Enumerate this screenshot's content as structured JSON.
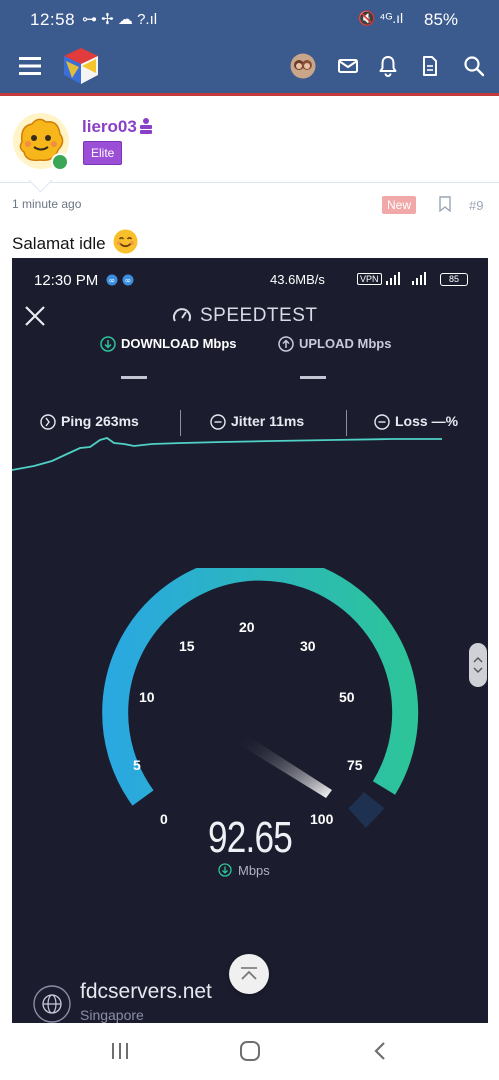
{
  "status_bar": {
    "time": "12:58",
    "left_icons_text": "⊶ ✢ ☁ ?.ıl",
    "right_icons_text": "🔇 ⁴ᴳ.ıl",
    "battery": "85%"
  },
  "app_header": {
    "icons": [
      "menu-icon",
      "site-logo",
      "user-avatar",
      "mail-icon",
      "bell-icon",
      "page-icon",
      "search-icon"
    ]
  },
  "post": {
    "author": "liero03",
    "badge": "Elite",
    "time": "1 minute ago",
    "new_label": "New",
    "post_number": "#9",
    "text": "Salamat idle"
  },
  "speedtest": {
    "status_time": "12:30 PM",
    "status_speed": "43.6MB/s",
    "vpn_label": "VPN",
    "battery": "85",
    "title": "SPEEDTEST",
    "download_label": "DOWNLOAD Mbps",
    "upload_label": "UPLOAD Mbps",
    "ping": "Ping 263ms",
    "jitter": "Jitter 11ms",
    "loss": "Loss —%",
    "speed_value": "92.65",
    "speed_unit": "Mbps",
    "gauge_ticks": [
      "0",
      "5",
      "10",
      "15",
      "20",
      "30",
      "50",
      "75",
      "100"
    ],
    "server_name": "fdcservers.net",
    "server_location": "Singapore"
  },
  "colors": {
    "header": "#3b5a8e",
    "accent_red": "#c43a3a",
    "username": "#8a3fc9",
    "gauge_start": "#2aa8e0",
    "gauge_end": "#2dc49a"
  }
}
